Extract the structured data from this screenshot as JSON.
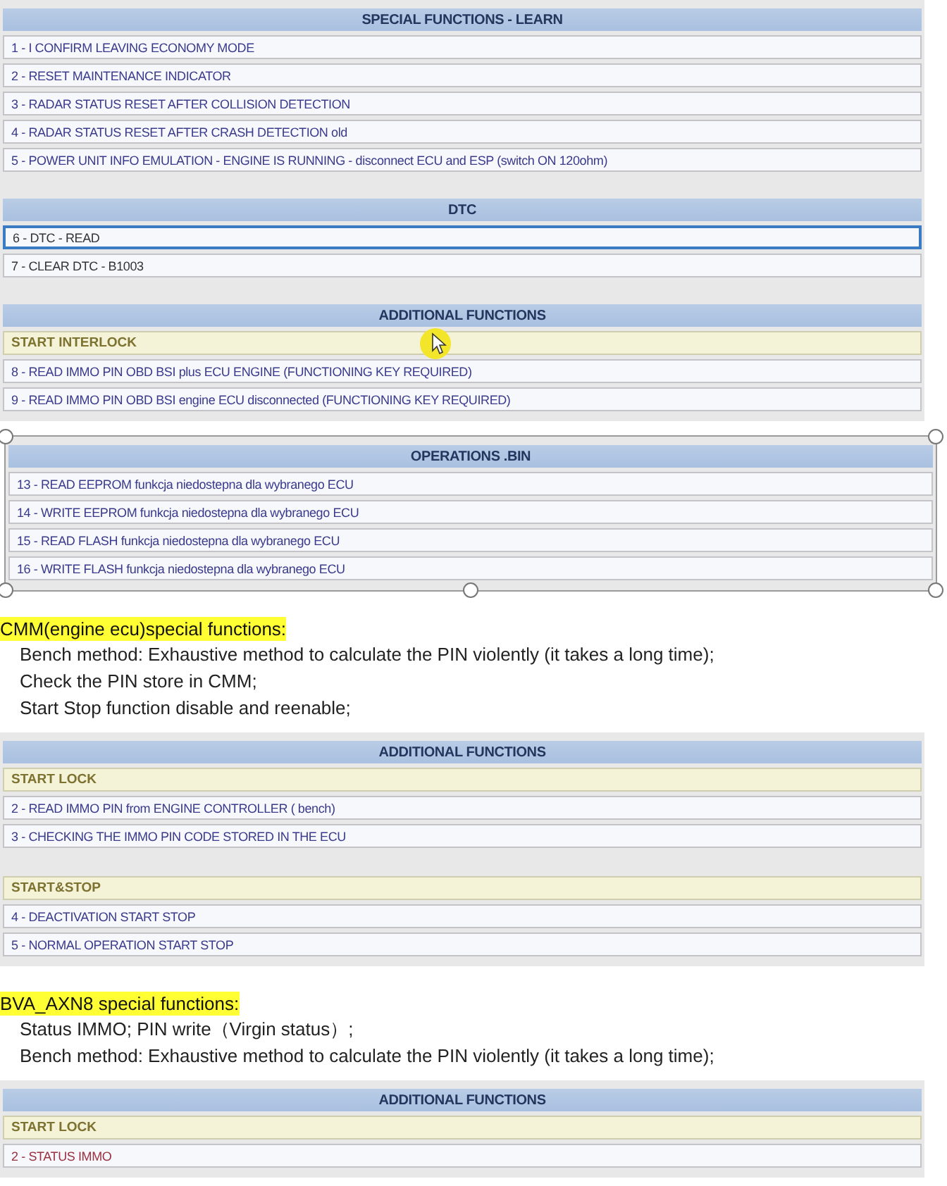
{
  "blocks": [
    {
      "kind": "panel",
      "framed": false,
      "sections": [
        {
          "title": "SPECIAL FUNCTIONS - LEARN",
          "groups": [
            {
              "rows": [
                {
                  "text": "1  - I CONFIRM LEAVING ECONOMY MODE",
                  "color": "#3a3a8c",
                  "selected": false
                },
                {
                  "text": "2  - RESET MAINTENANCE INDICATOR",
                  "color": "#3a3a8c",
                  "selected": false
                },
                {
                  "text": "3  -  RADAR STATUS RESET AFTER COLLISION DETECTION",
                  "color": "#3a3a8c",
                  "selected": false
                },
                {
                  "text": "4  -  RADAR STATUS RESET AFTER CRASH DETECTION old",
                  "color": "#3a3a8c",
                  "selected": false
                },
                {
                  "text": "5  - POWER UNIT INFO EMULATION - ENGINE IS RUNNING - disconnect ECU and ESP (switch ON 120ohm)",
                  "color": "#3a3a8c",
                  "selected": false
                }
              ]
            }
          ]
        },
        {
          "title": "DTC",
          "groups": [
            {
              "rows": [
                {
                  "text": "6  - DTC - READ",
                  "color": "#333333",
                  "selected": true
                },
                {
                  "text": "7  - CLEAR DTC - B1003",
                  "color": "#333333",
                  "selected": false
                }
              ]
            }
          ]
        },
        {
          "title": "ADDITIONAL FUNCTIONS",
          "cursor": true,
          "groups": [
            {
              "label": "START INTERLOCK",
              "rows": [
                {
                  "text": "8  - READ IMMO PIN OBD BSI plus ECU ENGINE (FUNCTIONING KEY REQUIRED)",
                  "color": "#3a3a8c",
                  "selected": false
                },
                {
                  "text": "9  - READ IMMO PIN OBD BSI engine ECU disconnected (FUNCTIONING KEY REQUIRED)",
                  "color": "#3a3a8c",
                  "selected": false
                }
              ]
            }
          ]
        }
      ]
    },
    {
      "kind": "panel",
      "framed": true,
      "sections": [
        {
          "title": "OPERATIONS .BIN",
          "groups": [
            {
              "rows": [
                {
                  "text": "13  - READ EEPROM  funkcja niedostepna dla wybranego ECU",
                  "color": "#3a3a8c",
                  "selected": false
                },
                {
                  "text": "14  - WRITE EEPROM  funkcja niedostepna dla wybranego ECU",
                  "color": "#3a3a8c",
                  "selected": false
                },
                {
                  "text": "15  - READ FLASH  funkcja niedostepna dla wybranego ECU",
                  "color": "#3a3a8c",
                  "selected": false
                },
                {
                  "text": "16  - WRITE FLASH  funkcja niedostepna dla wybranego ECU",
                  "color": "#3a3a8c",
                  "selected": false
                }
              ]
            }
          ]
        }
      ]
    },
    {
      "kind": "note",
      "heading": "CMM(engine ecu)special functions:",
      "lines": [
        "Bench method: Exhaustive method to calculate the PIN violently (it takes a long time);",
        "Check the PIN store in CMM;",
        "Start Stop function disable and reenable;"
      ]
    },
    {
      "kind": "panel",
      "framed": false,
      "sections": [
        {
          "title": "ADDITIONAL FUNCTIONS",
          "groups": [
            {
              "label": "START LOCK",
              "rows": [
                {
                  "text": "2  - READ IMMO PIN from ENGINE CONTROLLER ( bench)",
                  "color": "#3a3a8c",
                  "selected": false
                },
                {
                  "text": "3  - CHECKING THE IMMO PIN CODE STORED IN THE ECU",
                  "color": "#3a3a8c",
                  "selected": false
                }
              ]
            },
            {
              "label": "START&STOP",
              "rows": [
                {
                  "text": "4  -  DEACTIVATION START  STOP",
                  "color": "#3a3a8c",
                  "selected": false
                },
                {
                  "text": "5  -  NORMAL OPERATION START  STOP",
                  "color": "#3a3a8c",
                  "selected": false
                }
              ]
            }
          ]
        }
      ]
    },
    {
      "kind": "note",
      "heading": "BVA_AXN8 special functions:",
      "lines": [
        "Status IMMO;   PIN write（Virgin status）;",
        "Bench method: Exhaustive method to calculate the PIN violently (it takes a long time);"
      ]
    },
    {
      "kind": "panel",
      "framed": false,
      "sections": [
        {
          "title": "ADDITIONAL FUNCTIONS",
          "groups": [
            {
              "label": "START LOCK",
              "rows": [
                {
                  "text": "2  - STATUS IMMO",
                  "color": "#9a3040",
                  "selected": false
                }
              ]
            }
          ]
        }
      ]
    }
  ]
}
